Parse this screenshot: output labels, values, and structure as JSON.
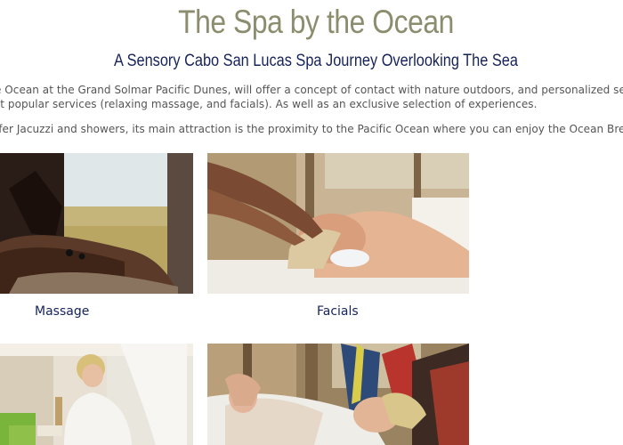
{
  "page": {
    "title": "The Spa by the Ocean",
    "subtitle": "A Sensory Cabo San Lucas Spa Journey Overlooking The Sea",
    "paragraph_line1": "e Ocean at the Grand Solmar Pacific Dunes, will offer a concept of contact with nature outdoors, and personalized servi",
    "paragraph_line2": "st popular services (relaxing massage, and facials). As well as an exclusive selection of experiences.",
    "paragraph_line3": "ffer Jacuzzi and showers, its main attraction is the proximity to the Pacific Ocean where you can enjoy the Ocean Breeze"
  },
  "gallery": {
    "items": [
      {
        "label": "Massage"
      },
      {
        "label": "Facials"
      },
      {
        "label": ""
      },
      {
        "label": ""
      }
    ]
  },
  "colors": {
    "title": "#8c8c6e",
    "heading_navy": "#16235a",
    "body_text": "#555555"
  }
}
